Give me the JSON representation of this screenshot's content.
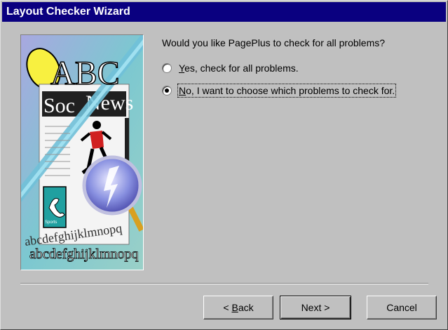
{
  "window": {
    "title": "Layout Checker Wizard"
  },
  "illustration": {
    "masthead_prefix": "Soc",
    "masthead_suffix": "News",
    "big_letters": "ABC",
    "caption": "Sports",
    "alphabet_line1": "abcdefghijklmnopq",
    "alphabet_line2": "abcdefghijklmnopq"
  },
  "question": "Would you like PagePlus to check for all problems?",
  "options": [
    {
      "underline": "Y",
      "rest": "es, check for all problems.",
      "selected": false
    },
    {
      "underline": "N",
      "rest": "o, I want to choose which problems to check for.",
      "selected": true
    }
  ],
  "buttons": {
    "back_prefix": "< ",
    "back_underline": "B",
    "back_rest": "ack",
    "next": "Next >",
    "cancel": "Cancel"
  }
}
